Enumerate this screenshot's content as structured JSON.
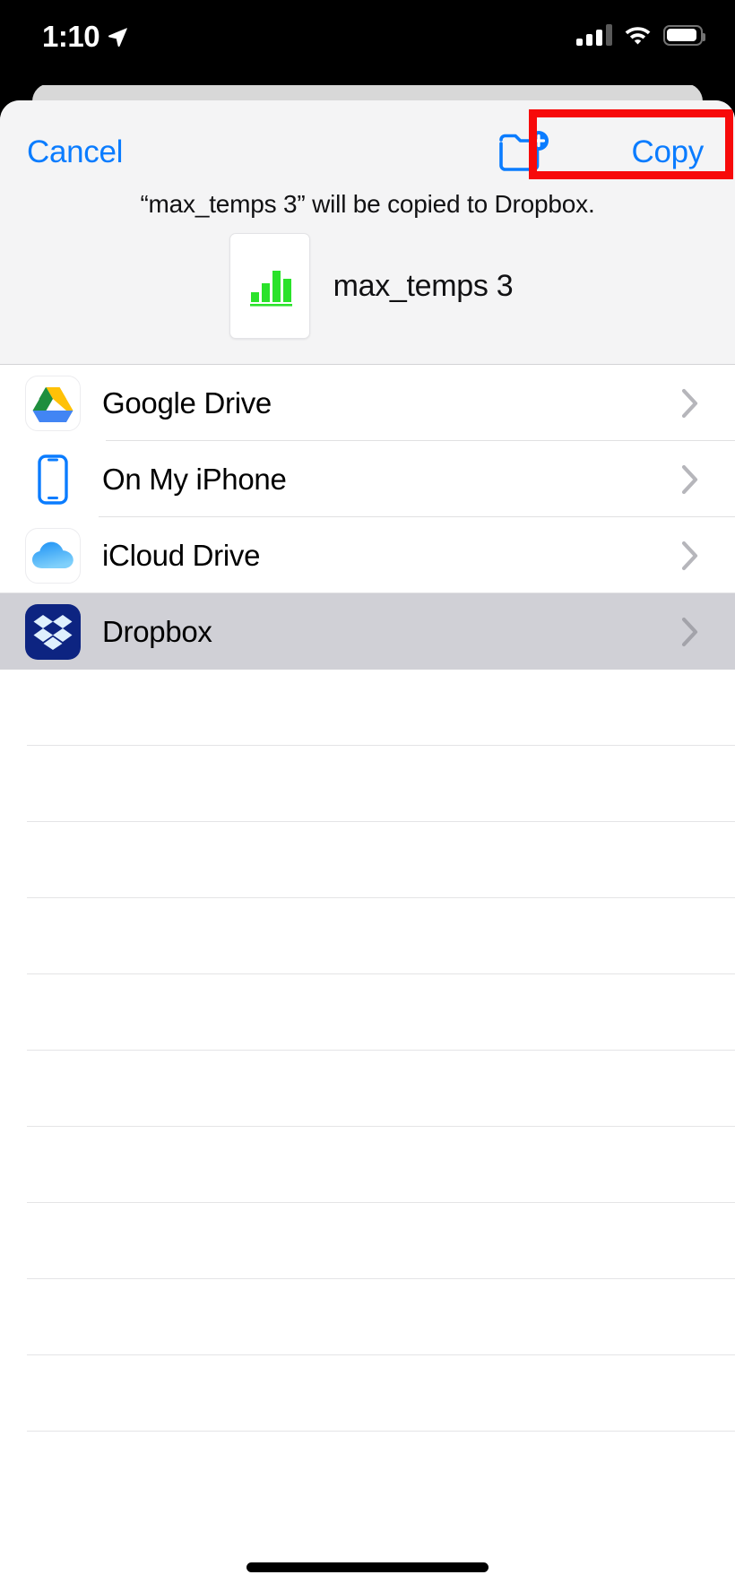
{
  "status_bar": {
    "time": "1:10",
    "location_icon": "location-arrow-icon",
    "cellular_icon": "cellular-signal-icon",
    "cellular_bars_filled": 3,
    "cellular_bars_total": 4,
    "wifi_icon": "wifi-icon",
    "battery_icon": "battery-icon",
    "battery_level_percent": 85
  },
  "sheet": {
    "header": {
      "cancel_label": "Cancel",
      "new_folder_icon": "new-folder-icon",
      "copy_label": "Copy",
      "highlight_color": "#f70a0a"
    },
    "caption": "“max_temps 3” will be copied to Dropbox.",
    "file": {
      "name": "max_temps 3",
      "thumbnail_icon": "numbers-bar-chart-icon",
      "thumbnail_chart_color": "#2ae22a"
    }
  },
  "locations": {
    "items": [
      {
        "label": "Google Drive",
        "icon": "google-drive-icon",
        "selected": false,
        "chevron": "chevron-right-icon"
      },
      {
        "label": "On My iPhone",
        "icon": "iphone-icon",
        "selected": false,
        "chevron": "chevron-right-icon"
      },
      {
        "label": "iCloud Drive",
        "icon": "icloud-drive-icon",
        "selected": false,
        "chevron": "chevron-right-icon"
      },
      {
        "label": "Dropbox",
        "icon": "dropbox-icon",
        "selected": true,
        "chevron": "chevron-right-icon"
      }
    ],
    "empty_row_count": 10
  },
  "home_indicator": "home-indicator"
}
